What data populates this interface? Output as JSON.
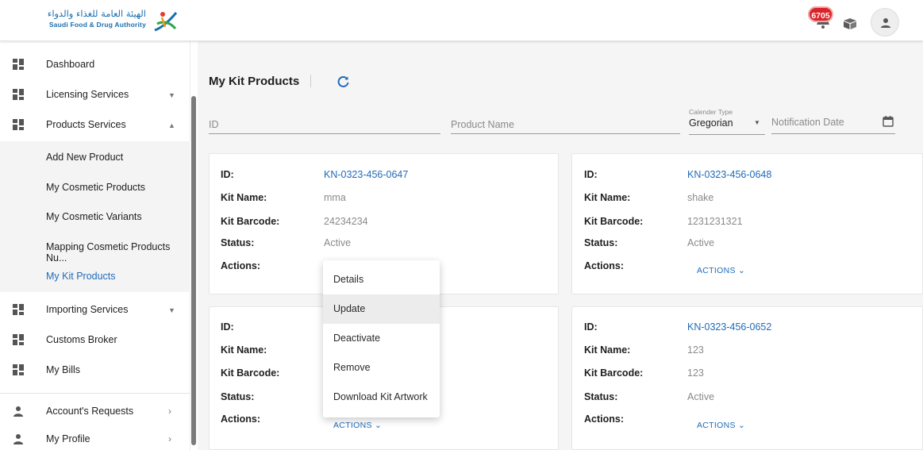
{
  "header": {
    "logo_ar": "الهيئة العامة للغذاء والدواء",
    "logo_en": "Saudi Food & Drug Authority",
    "notification_count": "6705"
  },
  "sidebar": {
    "items": [
      {
        "label": "Dashboard"
      },
      {
        "label": "Licensing Services"
      },
      {
        "label": "Products Services"
      },
      {
        "label": "Importing Services"
      },
      {
        "label": "Customs Broker"
      },
      {
        "label": "My Bills"
      },
      {
        "label": "Account's Requests"
      },
      {
        "label": "My Profile"
      }
    ],
    "sub_items": [
      {
        "label": "Add New Product"
      },
      {
        "label": "My Cosmetic Products"
      },
      {
        "label": "My Cosmetic Variants"
      },
      {
        "label": "Mapping Cosmetic Products Nu..."
      },
      {
        "label": "My Kit Products"
      }
    ]
  },
  "page": {
    "title": "My Kit Products"
  },
  "filters": {
    "id_placeholder": "ID",
    "product_name_placeholder": "Product Name",
    "calendar_type_label": "Calender Type",
    "calendar_type_value": "Gregorian",
    "notification_date_placeholder": "Notification Date"
  },
  "labels": {
    "id": "ID:",
    "kit_name": "Kit Name:",
    "kit_barcode": "Kit Barcode:",
    "status": "Status:",
    "actions": "Actions:",
    "actions_button": "ACTIONS"
  },
  "cards": [
    {
      "id": "KN-0323-456-0647",
      "kit_name": "mma",
      "kit_barcode": "24234234",
      "status": "Active"
    },
    {
      "id": "KN-0323-456-0648",
      "kit_name": "shake",
      "kit_barcode": "1231231321",
      "status": "Active"
    },
    {
      "id": "",
      "kit_name": "",
      "kit_barcode": "",
      "status": ""
    },
    {
      "id": "KN-0323-456-0652",
      "kit_name": "123",
      "kit_barcode": "123",
      "status": "Active"
    }
  ],
  "actions_menu": [
    {
      "label": "Details"
    },
    {
      "label": "Update"
    },
    {
      "label": "Deactivate"
    },
    {
      "label": "Remove"
    },
    {
      "label": "Download Kit Artwork"
    }
  ],
  "colors": {
    "accent": "#1f6bb8",
    "badge": "#d9252a"
  }
}
